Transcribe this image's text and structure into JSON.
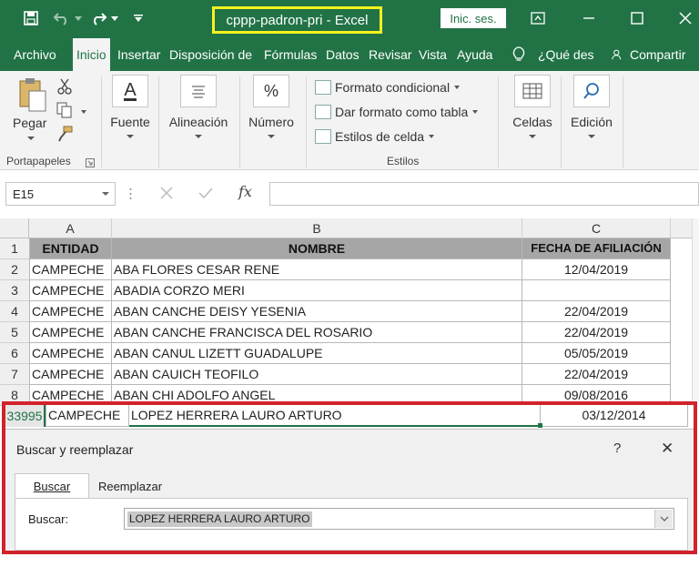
{
  "window": {
    "title": "cppp-padron-pri  -  Excel",
    "sign_in": "Inic. ses."
  },
  "menu": {
    "tabs": [
      "Archivo",
      "Inicio",
      "Insertar",
      "Disposición de",
      "Fórmulas",
      "Datos",
      "Revisar",
      "Vista",
      "Ayuda"
    ],
    "tell_me": "¿Qué des",
    "share": "Compartir"
  },
  "ribbon": {
    "paste": "Pegar",
    "clipboard_group": "Portapapeles",
    "font": "Fuente",
    "alignment": "Alineación",
    "number": "Número",
    "number_symbol": "%",
    "font_symbol": "A",
    "cond_format": "Formato condicional",
    "table_format": "Dar formato como tabla",
    "cell_styles": "Estilos de celda",
    "styles_group": "Estilos",
    "cells": "Celdas",
    "editing": "Edición"
  },
  "formula_bar": {
    "name_box": "E15",
    "fx": "fx"
  },
  "sheet": {
    "columns": [
      "A",
      "B",
      "C"
    ],
    "header_row": [
      "ENTIDAD",
      "NOMBRE",
      "FECHA  DE AFILIACIÓN"
    ],
    "rows": [
      {
        "num": "1"
      },
      {
        "num": "2",
        "a": "CAMPECHE",
        "b": "ABA FLORES CESAR RENE",
        "c": "12/04/2019"
      },
      {
        "num": "3",
        "a": "CAMPECHE",
        "b": "ABADIA CORZO MERI",
        "c": ""
      },
      {
        "num": "4",
        "a": "CAMPECHE",
        "b": "ABAN CANCHE DEISY YESENIA",
        "c": "22/04/2019"
      },
      {
        "num": "5",
        "a": "CAMPECHE",
        "b": "ABAN CANCHE FRANCISCA DEL ROSARIO",
        "c": "22/04/2019"
      },
      {
        "num": "6",
        "a": "CAMPECHE",
        "b": "ABAN CANUL LIZETT GUADALUPE",
        "c": "05/05/2019"
      },
      {
        "num": "7",
        "a": "CAMPECHE",
        "b": "ABAN CAUICH TEOFILO",
        "c": "22/04/2019"
      },
      {
        "num": "8",
        "a": "CAMPECHE",
        "b": "ABAN CHI ADOLFO ANGEL",
        "c": "09/08/2016"
      }
    ],
    "found_row": {
      "num": "33995",
      "a": "CAMPECHE",
      "b": "LOPEZ HERRERA LAURO ARTURO",
      "c": "03/12/2014"
    }
  },
  "dialog": {
    "title": "Buscar y reemplazar",
    "help": "?",
    "close": "✕",
    "tab_find": "Buscar",
    "tab_replace": "Reemplazar",
    "find_label": "Buscar:",
    "find_value": "LOPEZ HERRERA LAURO ARTURO"
  },
  "colors": {
    "excel_green": "#217346",
    "title_highlight": "#f4f21e",
    "annotation_red": "#d2222b",
    "header_gray": "#a6a6a6"
  }
}
